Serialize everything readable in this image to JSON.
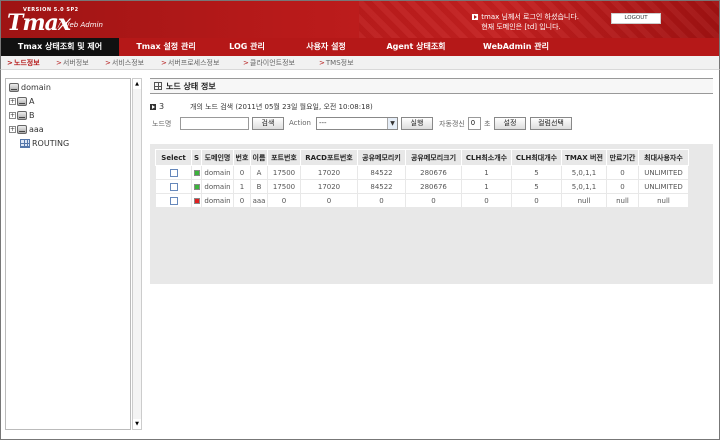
{
  "header": {
    "version": "VERSION 5.0 SP2",
    "logo": "Tmax",
    "logo_sub": "/ Web Admin",
    "user_line1": "tmax 님께서 로그인 하셨습니다.",
    "user_line2": "현재 도메인은 [td] 입니다.",
    "logout_label": "LOGOUT"
  },
  "nav": {
    "items": [
      {
        "label": "Tmax 상태조회 및 제어"
      },
      {
        "label": "Tmax 설정 관리"
      },
      {
        "label": "LOG 관리"
      },
      {
        "label": "사용자 설정"
      },
      {
        "label": "Agent 상태조회"
      },
      {
        "label": "WebAdmin 관리"
      }
    ]
  },
  "subnav": {
    "items": [
      {
        "label": "노드정보"
      },
      {
        "label": "서버정보"
      },
      {
        "label": "서비스정보"
      },
      {
        "label": "서버프로세스정보"
      },
      {
        "label": "클라이언트정보"
      },
      {
        "label": "TMS정보"
      }
    ]
  },
  "tree": {
    "root": "domain",
    "nodes": [
      {
        "label": "A",
        "expander": "+"
      },
      {
        "label": "B",
        "expander": "+"
      },
      {
        "label": "aaa",
        "expander": "+"
      },
      {
        "label": "ROUTING",
        "expander": ""
      }
    ],
    "scroll_up": "▲",
    "scroll_down": "▼"
  },
  "main": {
    "title": "노드 상태 정보",
    "count": "3",
    "count_text": "개의 노드 검색 (2011년 05월 23일 월요일, 오전 10:08:18)",
    "search": {
      "node_label": "노드명",
      "node_value": "",
      "search_button": "검색",
      "action_label": "Action",
      "action_value": "---",
      "run_button": "실행",
      "auto_refresh_label": "자동갱신",
      "auto_refresh_value": "0",
      "seconds_label": "초",
      "settings_button": "설정",
      "columns_button": "컬럼선택"
    },
    "table": {
      "columns": [
        "Select",
        "S",
        "도메인명",
        "번호",
        "이름",
        "포트번호",
        "RACD포트번호",
        "공유메모리키",
        "공유메모리크기",
        "CLH최소개수",
        "CLH최대개수",
        "TMAX 버전",
        "만료기간",
        "최대사용자수"
      ],
      "rows": [
        {
          "status": "running",
          "cells": [
            "domain",
            "0",
            "A",
            "17500",
            "17020",
            "84522",
            "280676",
            "1",
            "5",
            "5,0,1,1",
            "0",
            "UNLIMITED"
          ]
        },
        {
          "status": "running",
          "cells": [
            "domain",
            "1",
            "B",
            "17500",
            "17020",
            "84522",
            "280676",
            "1",
            "5",
            "5,0,1,1",
            "0",
            "UNLIMITED"
          ]
        },
        {
          "status": "stopped",
          "cells": [
            "domain",
            "0",
            "aaa",
            "0",
            "0",
            "0",
            "0",
            "0",
            "0",
            "null",
            "null",
            "null"
          ]
        }
      ]
    }
  },
  "colors": {
    "header_red": "#b51818",
    "active_nav": "#111111",
    "status_running": "#3bb43b",
    "status_stopped": "#e02020"
  }
}
